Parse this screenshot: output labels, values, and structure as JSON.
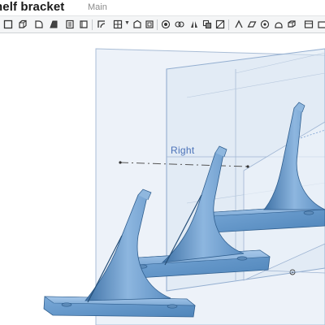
{
  "document": {
    "title": "helf bracket",
    "workspace": "Main"
  },
  "toolbar": {
    "buttons": [
      {
        "icon": "sketch-icon"
      },
      {
        "icon": "extrude-icon"
      },
      {
        "icon": "revolve-icon"
      },
      {
        "icon": "sweep-icon"
      },
      {
        "icon": "loft-icon"
      },
      {
        "icon": "thicken-icon"
      },
      {
        "icon": "fillet-icon"
      },
      {
        "icon": "chamfer-icon"
      },
      {
        "icon": "draft-icon"
      },
      {
        "icon": "shell-icon"
      },
      {
        "icon": "hole-icon"
      },
      {
        "icon": "pattern-icon"
      },
      {
        "icon": "mirror-icon"
      },
      {
        "icon": "boolean-icon"
      },
      {
        "icon": "split-icon"
      },
      {
        "icon": "transform-icon"
      },
      {
        "icon": "plane-icon"
      },
      {
        "icon": "mate-connector-icon"
      },
      {
        "icon": "wrap-icon"
      },
      {
        "icon": "delete-part-icon"
      }
    ]
  },
  "viewport": {
    "plane_label": "Right",
    "colors": {
      "part": "#5a8fc4",
      "part_shadow": "#3e6f9f",
      "plane_fill": "#e6eef8",
      "plane_edge": "#9fb6d3"
    }
  }
}
